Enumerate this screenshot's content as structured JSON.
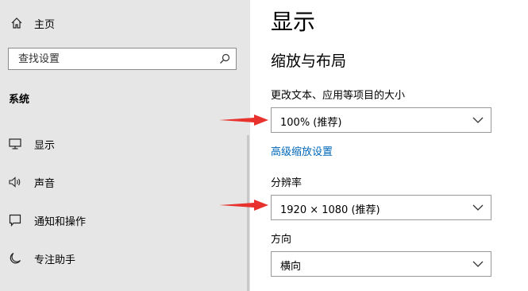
{
  "sidebar": {
    "home_label": "主页",
    "search_placeholder": "查找设置",
    "section_title": "系统",
    "items": [
      {
        "label": "显示",
        "icon": "monitor-icon"
      },
      {
        "label": "声音",
        "icon": "speaker-icon"
      },
      {
        "label": "通知和操作",
        "icon": "notification-icon"
      },
      {
        "label": "专注助手",
        "icon": "moon-icon"
      }
    ]
  },
  "main": {
    "title": "显示",
    "section_title": "缩放与布局",
    "scale_label": "更改文本、应用等项目的大小",
    "scale_value": "100% (推荐)",
    "advanced_link": "高级缩放设置",
    "resolution_label": "分辨率",
    "resolution_value": "1920 × 1080 (推荐)",
    "orientation_label": "方向",
    "orientation_value": "横向"
  },
  "colors": {
    "sidebar_bg": "#e6e6e6",
    "link": "#0067b8",
    "arrow": "#e8322e"
  }
}
